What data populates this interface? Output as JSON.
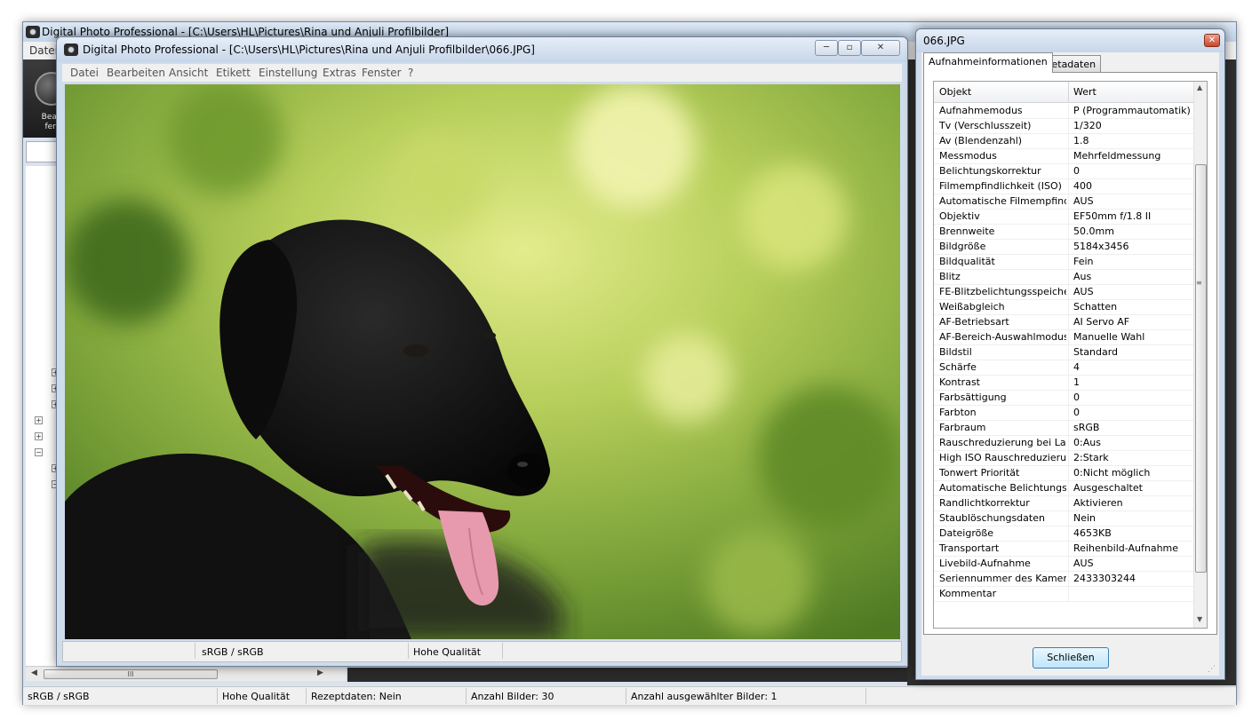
{
  "main_window": {
    "title": "Digital Photo Professional - [C:\\Users\\HL\\Pictures\\Rina und Anjuli Profilbilder]",
    "menu_first": "Datei",
    "toolbar_edit_label": "Bearb fens",
    "scroll_grip": "III",
    "status": {
      "color_space": "sRGB / sRGB",
      "quality": "Hohe Qualität",
      "recipe": "Rezeptdaten: Nein",
      "count": "Anzahl Bilder: 30",
      "selected": "Anzahl ausgewählter Bilder: 1"
    }
  },
  "viewer_window": {
    "title": "Digital Photo Professional - [C:\\Users\\HL\\Pictures\\Rina und Anjuli Profilbilder\\066.JPG]",
    "menu": [
      "Datei",
      "Bearbeiten",
      "Ansicht",
      "Etikett",
      "Einstellung",
      "Extras",
      "Fenster",
      "?"
    ],
    "status": {
      "color_space": "sRGB / sRGB",
      "quality": "Hohe Qualität"
    }
  },
  "info_dialog": {
    "title": "066.JPG",
    "tabs": [
      "Aufnahmeinformationen",
      "Metadaten"
    ],
    "table_headers": [
      "Objekt",
      "Wert"
    ],
    "rows": [
      [
        "Aufnahmemodus",
        "P (Programmautomatik)"
      ],
      [
        "Tv (Verschlusszeit)",
        "1/320"
      ],
      [
        "Av (Blendenzahl)",
        "1.8"
      ],
      [
        "Messmodus",
        "Mehrfeldmessung"
      ],
      [
        "Belichtungskorrektur",
        "0"
      ],
      [
        "Filmempfindlichkeit (ISO)",
        "400"
      ],
      [
        "Automatische Filmempfindli...",
        "AUS"
      ],
      [
        "Objektiv",
        "EF50mm f/1.8 II"
      ],
      [
        "Brennweite",
        "50.0mm"
      ],
      [
        "Bildgröße",
        "5184x3456"
      ],
      [
        "Bildqualität",
        "Fein"
      ],
      [
        "Blitz",
        "Aus"
      ],
      [
        "FE-Blitzbelichtungsspeicher...",
        "AUS"
      ],
      [
        "Weißabgleich",
        "Schatten"
      ],
      [
        "AF-Betriebsart",
        "AI Servo AF"
      ],
      [
        "AF-Bereich-Auswahlmodus",
        "Manuelle  Wahl"
      ],
      [
        "Bildstil",
        "Standard"
      ],
      [
        "Schärfe",
        "4"
      ],
      [
        "Kontrast",
        "1"
      ],
      [
        "Farbsättigung",
        "0"
      ],
      [
        "Farbton",
        "0"
      ],
      [
        "Farbraum",
        "sRGB"
      ],
      [
        "Rauschreduzierung bei Lan...",
        "0:Aus"
      ],
      [
        "High ISO Rauschreduzierung",
        "2:Stark"
      ],
      [
        "Tonwert Priorität",
        "0:Nicht möglich"
      ],
      [
        "Automatische Belichtungso...",
        "Ausgeschaltet"
      ],
      [
        "Randlichtkorrektur",
        "Aktivieren"
      ],
      [
        "Staublöschungsdaten",
        "Nein"
      ],
      [
        "Dateigröße",
        "4653KB"
      ],
      [
        "Transportart",
        "Reihenbild-Aufnahme"
      ],
      [
        "Livebild-Aufnahme",
        "AUS"
      ],
      [
        "Seriennummer des Kamera...",
        "2433303244"
      ],
      [
        "Kommentar",
        ""
      ]
    ],
    "close_label": "Schließen"
  }
}
